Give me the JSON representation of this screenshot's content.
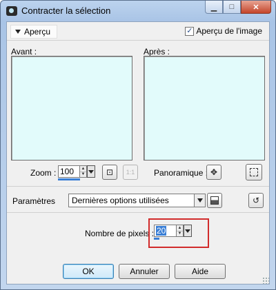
{
  "window": {
    "title": "Contracter la sélection",
    "caption_buttons": {
      "minimize": "▁",
      "maximize": "□",
      "close": "✕"
    }
  },
  "preview": {
    "toggle_label": "Aperçu",
    "image_preview_label": "Aperçu de l'image",
    "image_preview_checked": true
  },
  "panes": {
    "before_label": "Avant :",
    "after_label": "Après :",
    "pane_color": "#e2fbfb"
  },
  "zoom": {
    "label": "Zoom :",
    "value": "100",
    "fit_icon": "zoom-fit-icon",
    "actual_size_label": "1:1"
  },
  "pan": {
    "label": "Panoramique :",
    "pan_icon": "move-icon",
    "selection_icon": "marquee-icon"
  },
  "presets": {
    "label": "Paramètres",
    "selected": "Dernières options utilisées",
    "save_icon": "save-icon",
    "reset_icon": "reset-icon"
  },
  "pixels": {
    "label": "Nombre de pixels :",
    "value": "20"
  },
  "buttons": {
    "ok": "OK",
    "cancel": "Annuler",
    "help": "Aide"
  },
  "colors": {
    "highlight": "#d12a2a",
    "accent": "#3a7fd6"
  }
}
